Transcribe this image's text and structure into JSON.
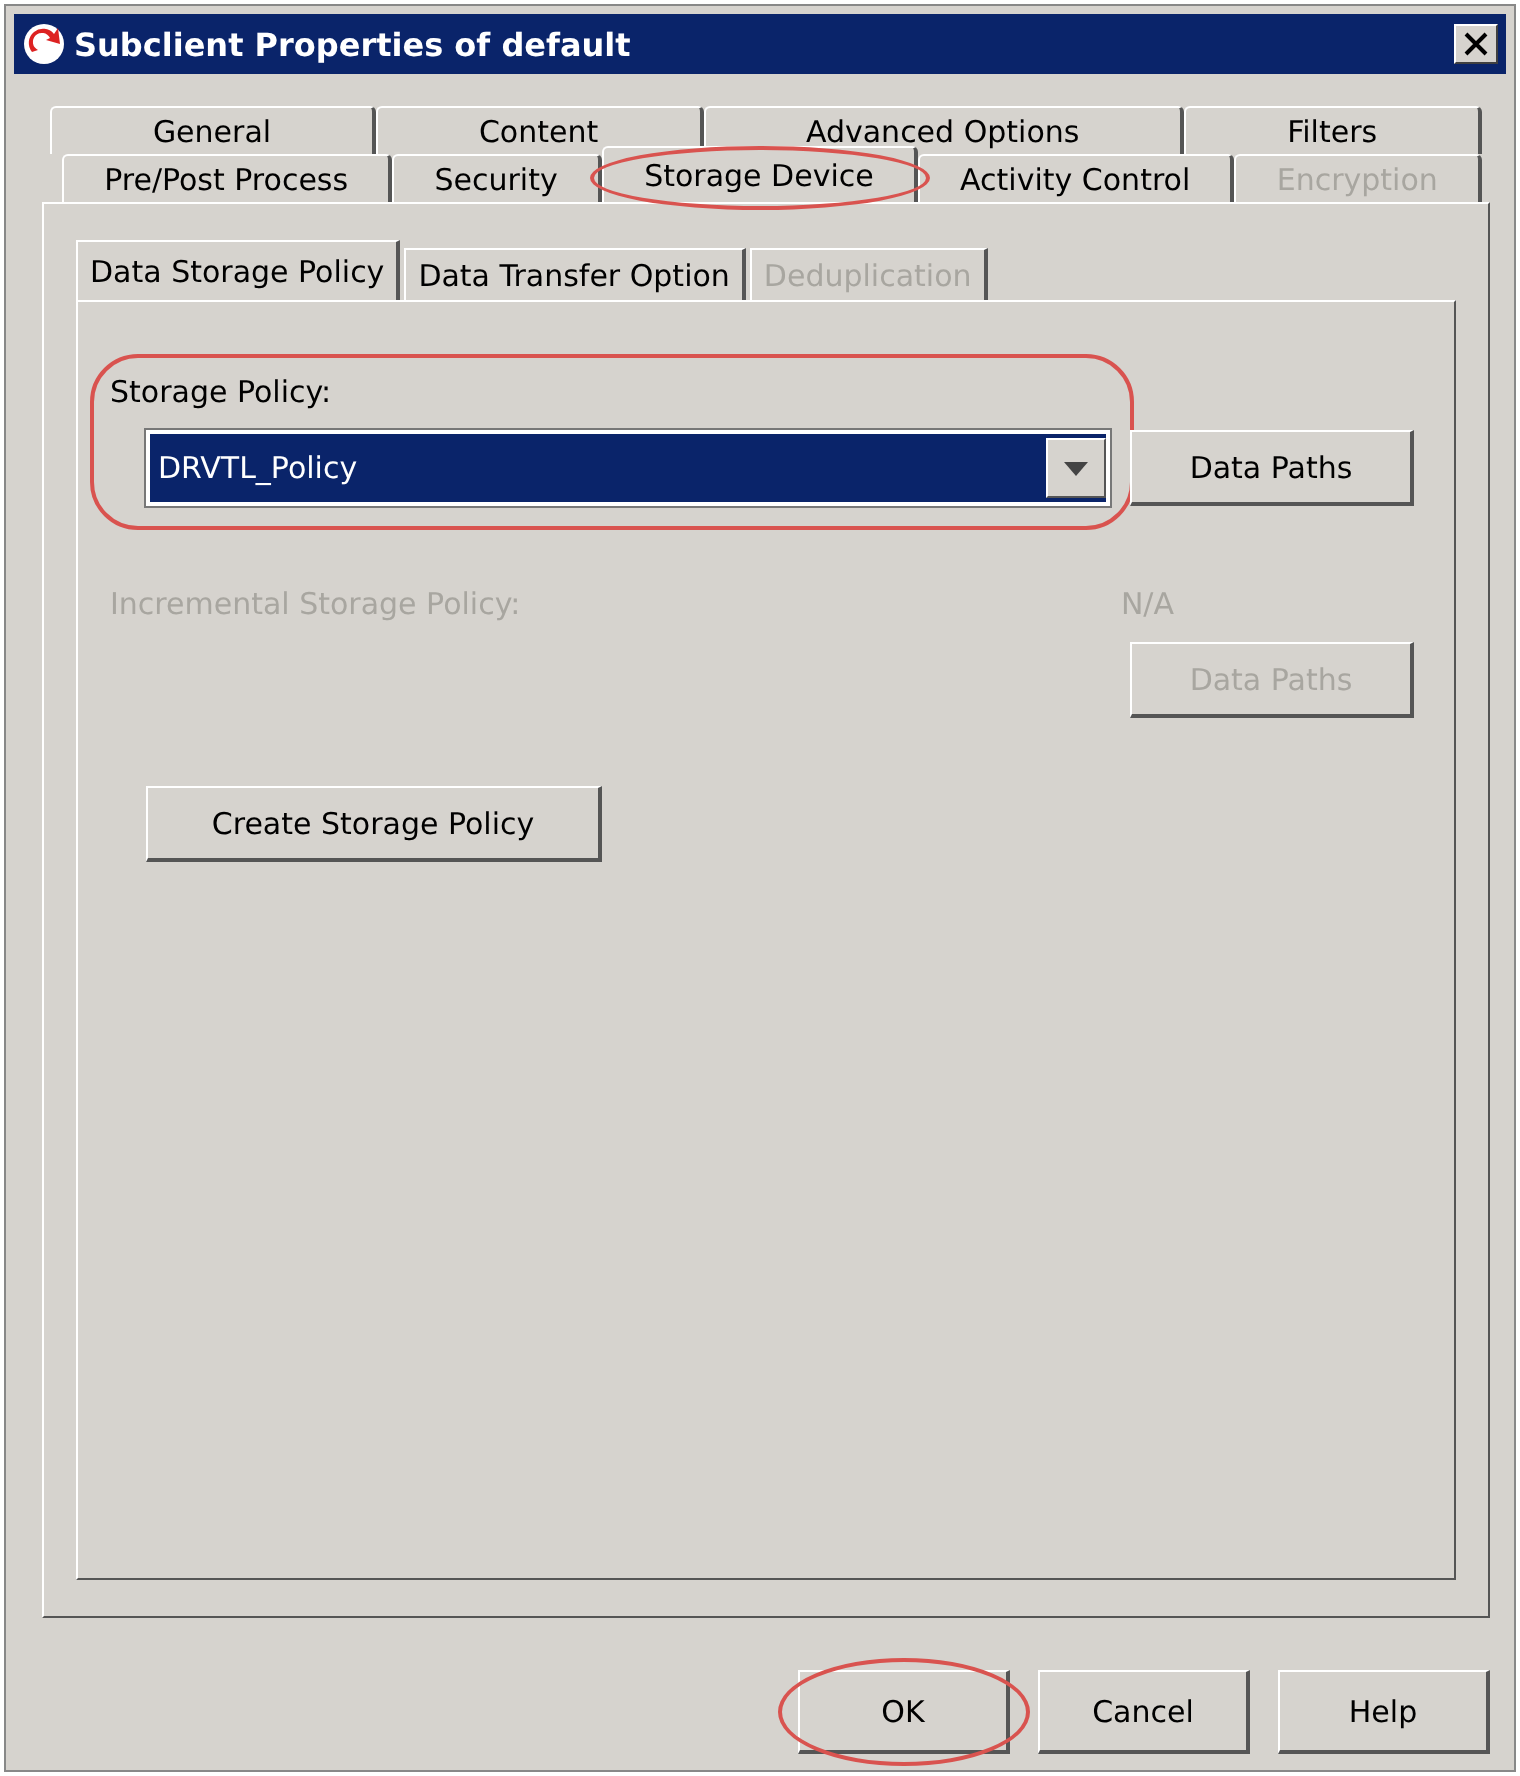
{
  "window": {
    "title": "Subclient Properties of default"
  },
  "tab_rows": [
    [
      {
        "label": "General",
        "selected": false,
        "disabled": false,
        "highlighted": false
      },
      {
        "label": "Content",
        "selected": false,
        "disabled": false,
        "highlighted": false
      },
      {
        "label": "Advanced Options",
        "selected": false,
        "disabled": false,
        "highlighted": false
      },
      {
        "label": "Filters",
        "selected": false,
        "disabled": false,
        "highlighted": false
      }
    ],
    [
      {
        "label": "Pre/Post Process",
        "selected": false,
        "disabled": false,
        "highlighted": false
      },
      {
        "label": "Security",
        "selected": false,
        "disabled": false,
        "highlighted": false
      },
      {
        "label": "Storage Device",
        "selected": true,
        "disabled": false,
        "highlighted": true
      },
      {
        "label": "Activity Control",
        "selected": false,
        "disabled": false,
        "highlighted": false
      },
      {
        "label": "Encryption",
        "selected": false,
        "disabled": true,
        "highlighted": false
      }
    ]
  ],
  "subtabs": [
    {
      "label": "Data Storage Policy",
      "selected": true,
      "disabled": false
    },
    {
      "label": "Data Transfer Option",
      "selected": false,
      "disabled": false
    },
    {
      "label": "Deduplication",
      "selected": false,
      "disabled": true
    }
  ],
  "storage_policy": {
    "label": "Storage Policy:",
    "value": "DRVTL_Policy",
    "highlighted": true,
    "button": {
      "label": "Data Paths",
      "disabled": false
    }
  },
  "incremental_policy": {
    "label": "Incremental Storage Policy:",
    "value": "N/A",
    "disabled": true,
    "button": {
      "label": "Data Paths",
      "disabled": true
    }
  },
  "create_button": {
    "label": "Create Storage Policy",
    "disabled": false
  },
  "buttons": [
    {
      "label": "OK",
      "highlighted": true
    },
    {
      "label": "Cancel",
      "highlighted": false
    },
    {
      "label": "Help",
      "highlighted": false
    }
  ]
}
